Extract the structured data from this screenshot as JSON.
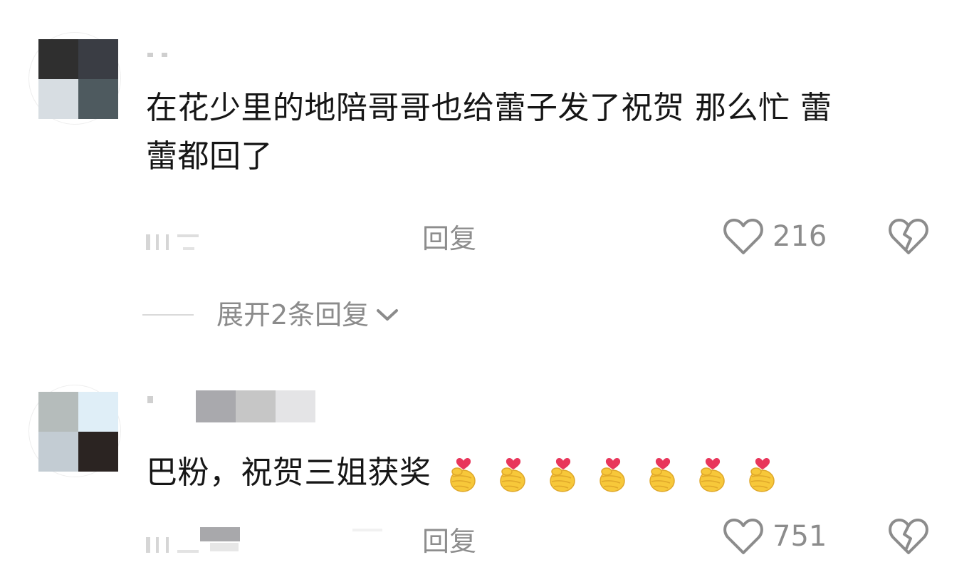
{
  "comments": [
    {
      "text_line1": "在花少里的地陪哥哥也给蕾子发了祝贺 那么忙 蕾",
      "text_line2": "蕾都回了",
      "reply_label": "回复",
      "like_count": "216",
      "expand_label": "展开2条回复"
    },
    {
      "text": "巴粉，祝贺三姐获奖",
      "emoji_name": "finger-heart-emoji",
      "emoji_count": 7,
      "reply_label": "回复",
      "like_count": "751"
    }
  ],
  "icons": {
    "like": "heart-outline-icon",
    "dislike": "broken-heart-icon",
    "expand": "chevron-down-icon"
  },
  "colors": {
    "text": "#161616",
    "muted": "#8c8c8c",
    "emoji_yellow": "#f7c83a",
    "emoji_heart": "#e8365b"
  }
}
